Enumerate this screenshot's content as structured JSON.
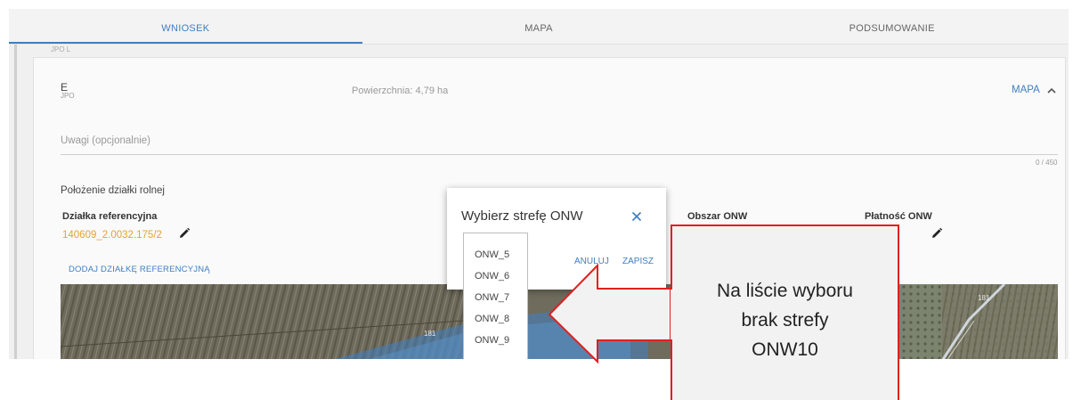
{
  "tabs": [
    {
      "label": "WNIOSEK",
      "active": true
    },
    {
      "label": "MAPA",
      "active": false
    },
    {
      "label": "PODSUMOWANIE",
      "active": false
    }
  ],
  "prev_card_fragment": "JPO L",
  "parcel": {
    "letter": "E",
    "jpo": "JPO",
    "area": "Powierzchnia: 4,79 ha",
    "map_link": "MAPA"
  },
  "notes": {
    "placeholder": "Uwagi (opcjonalnie)",
    "counter": "0 / 450"
  },
  "location": {
    "title": "Położenie działki rolnej",
    "columns": {
      "reference": "Działka referencyjna",
      "onw_area": "Obszar ONW",
      "onw_payment": "Płatność ONW"
    },
    "reference_id": "140609_2.0032.175/2",
    "add_reference": "DODAJ DZIAŁKĘ REFERENCYJNĄ"
  },
  "aerial_labels": [
    "181",
    "181"
  ],
  "dialog": {
    "title": "Wybierz strefę ONW",
    "cancel": "ANULUJ",
    "save": "ZAPISZ",
    "options": [
      "ONW_5",
      "ONW_6",
      "ONW_7",
      "ONW_8",
      "ONW_9"
    ]
  },
  "callout": {
    "lines": [
      "Na liście wyboru",
      "brak strefy",
      "ONW10"
    ]
  },
  "colors": {
    "accent": "#3f7fc1",
    "parcel_id": "#e4a331",
    "callout_border": "#e02020"
  },
  "icons": [
    "pencil-icon",
    "close-icon",
    "chevron-up-icon"
  ]
}
